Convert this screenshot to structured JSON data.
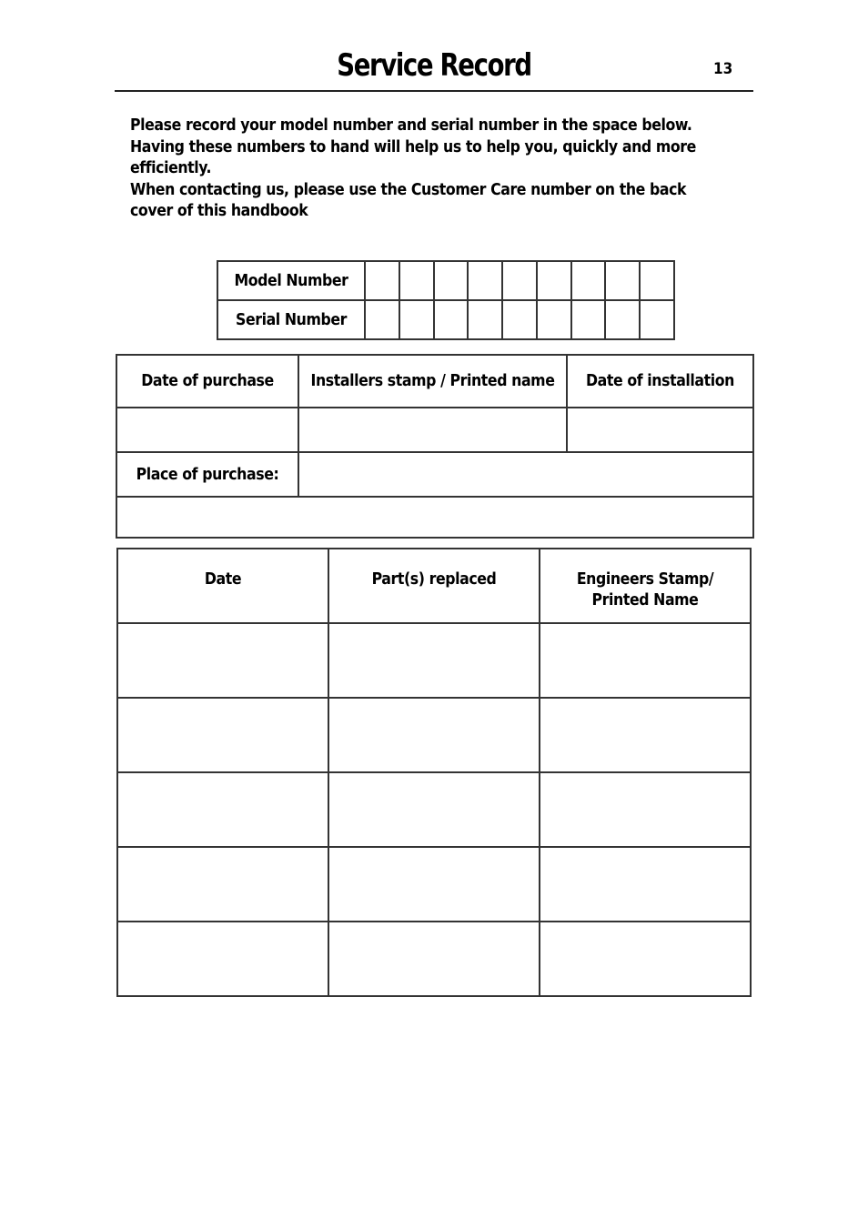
{
  "header": {
    "title": "Service Record",
    "page_number": "13"
  },
  "intro": {
    "paragraph_1": "Please record your model number and serial number in the space below. Having these numbers to hand will help us to help you, quickly and more efficiently.",
    "paragraph_2": "When contacting us, please use the Customer Care number on the back cover of this handbook"
  },
  "identification": {
    "model_label": "Model Number",
    "serial_label": "Serial Number",
    "boxes_per_row": 9,
    "model_value": [
      "",
      "",
      "",
      "",
      "",
      "",
      "",
      "",
      ""
    ],
    "serial_value": [
      "",
      "",
      "",
      "",
      "",
      "",
      "",
      "",
      ""
    ]
  },
  "purchase": {
    "headers": [
      "Date of purchase",
      "Installers stamp / Printed name",
      "Date of installation"
    ],
    "values": [
      "",
      "",
      ""
    ],
    "place_label": "Place of purchase:",
    "place_value": "",
    "extra_value": ""
  },
  "service": {
    "headers": [
      "Date",
      "Part(s) replaced",
      "Engineers Stamp/ Printed Name"
    ],
    "rows": [
      [
        "",
        "",
        ""
      ],
      [
        "",
        "",
        ""
      ],
      [
        "",
        "",
        ""
      ],
      [
        "",
        "",
        ""
      ],
      [
        "",
        "",
        ""
      ]
    ]
  }
}
